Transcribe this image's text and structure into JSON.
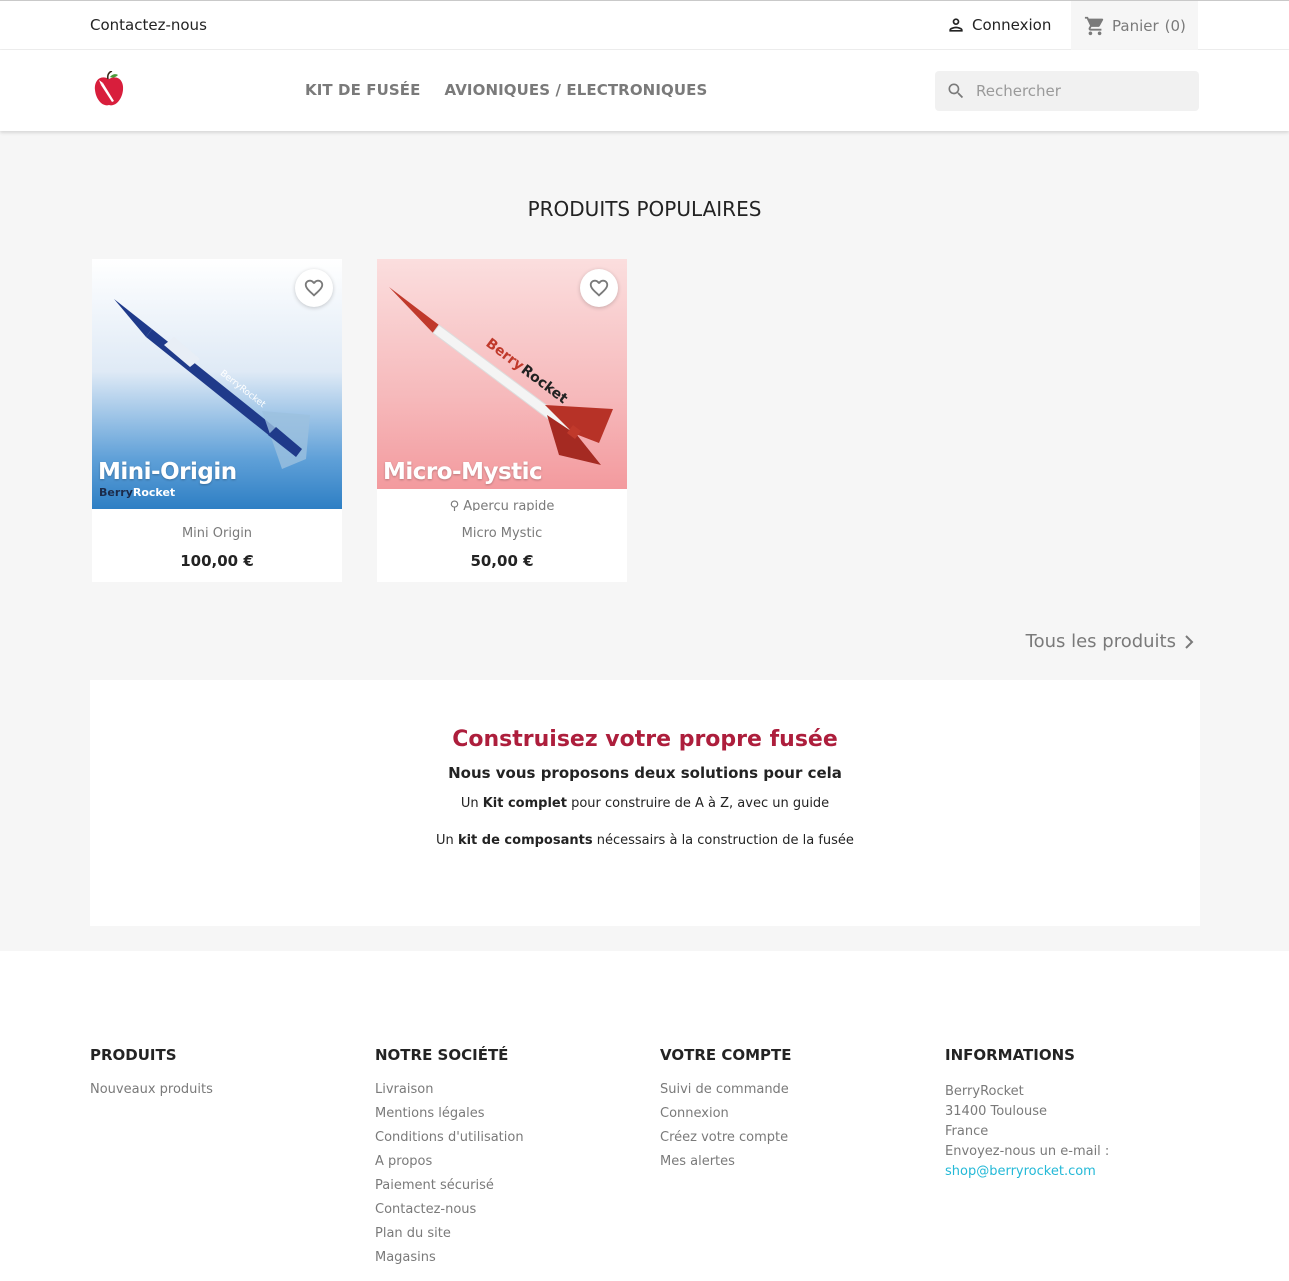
{
  "topbar": {
    "contact_label": "Contactez-nous",
    "login_label": "Connexion",
    "cart_label": "Panier",
    "cart_count": "(0)"
  },
  "header": {
    "logo_icon": "apple-rocket-logo-icon",
    "nav": [
      "KIT DE FUSÉE",
      "AVIONIQUES / ELECTRONIQUES"
    ],
    "search_placeholder": "Rechercher"
  },
  "main": {
    "section_title": "PRODUITS POPULAIRES",
    "products": [
      {
        "image_title": "Mini-Origin",
        "image_brand_a": "Berry",
        "image_brand_b": "Rocket",
        "name": "Mini Origin",
        "price": "100,00 €",
        "quick_view": ""
      },
      {
        "image_title": "Micro-Mystic",
        "image_brand_a": "Berry",
        "image_brand_b": "Rocket",
        "name": "Micro Mystic",
        "price": "50,00 €",
        "quick_view": "Aperçu rapide"
      }
    ],
    "all_products_label": "Tous les produits",
    "promo": {
      "title": "Construisez votre propre fusée",
      "subtitle": "Nous vous proposons deux solutions pour cela",
      "line1_a": "Un ",
      "line1_b": "Kit complet",
      "line1_c": " pour construire de A à Z, avec un guide",
      "line2_a": "Un ",
      "line2_b": "kit de composants",
      "line2_c": " nécessairs à la construction de la fusée"
    }
  },
  "footer": {
    "col1": {
      "title": "PRODUITS",
      "links": [
        "Nouveaux produits"
      ]
    },
    "col2": {
      "title": "NOTRE SOCIÉTÉ",
      "links": [
        "Livraison",
        "Mentions légales",
        "Conditions d'utilisation",
        "A propos",
        "Paiement sécurisé",
        "Contactez-nous",
        "Plan du site",
        "Magasins"
      ]
    },
    "col3": {
      "title": "VOTRE COMPTE",
      "links": [
        "Suivi de commande",
        "Connexion",
        "Créez votre compte",
        "Mes alertes"
      ]
    },
    "col4": {
      "title": "INFORMATIONS",
      "lines": [
        "BerryRocket",
        "31400 Toulouse",
        "France",
        "Envoyez-nous un e-mail :"
      ],
      "email": "shop@berryrocket.com"
    }
  },
  "colors": {
    "accent": "#ad1e3c",
    "link": "#24b9d7",
    "muted": "#7a7a7a"
  }
}
